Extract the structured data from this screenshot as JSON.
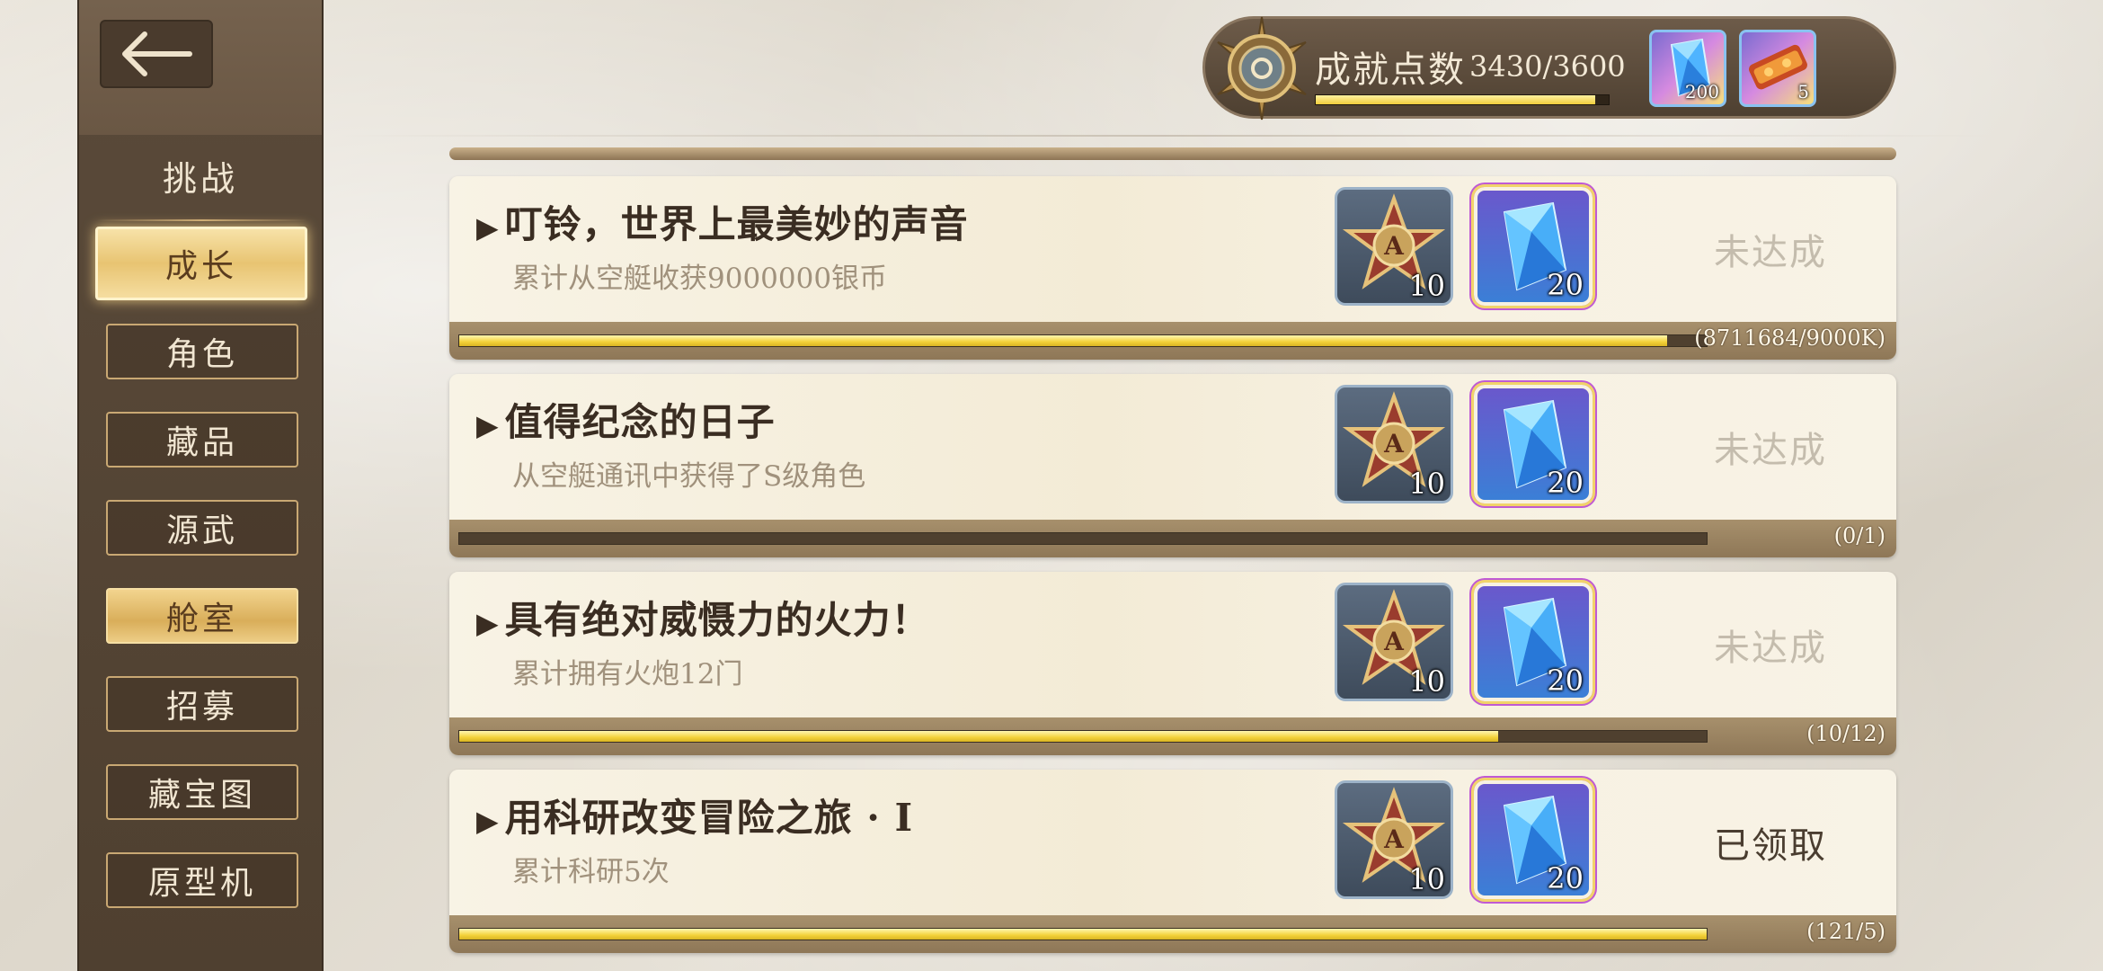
{
  "sidebar": {
    "back_icon": "back-arrow-icon",
    "section_label": "挑战",
    "items": [
      {
        "label": "成长",
        "state": "active"
      },
      {
        "label": "角色",
        "state": "normal"
      },
      {
        "label": "藏品",
        "state": "normal"
      },
      {
        "label": "源武",
        "state": "normal"
      },
      {
        "label": "舱室",
        "state": "highlight"
      },
      {
        "label": "招募",
        "state": "normal"
      },
      {
        "label": "藏宝图",
        "state": "normal"
      },
      {
        "label": "原型机",
        "state": "normal"
      }
    ]
  },
  "header": {
    "points_label": "成就点数",
    "points_value": "3430/3600",
    "points_progress": 0.953,
    "rewards": [
      {
        "icon": "blue-crystal-icon",
        "count": "200"
      },
      {
        "icon": "red-scroll-icon",
        "count": "5"
      }
    ]
  },
  "achievements": [
    {
      "title": "叮铃，世界上最美妙的声音",
      "desc": "累计从空艇收获9000000银币",
      "reward_star_count": "10",
      "reward_crystal_count": "20",
      "status": "未达成",
      "progress_text": "(8711684/9000K)",
      "progress": 0.968
    },
    {
      "title": "值得纪念的日子",
      "desc": "从空艇通讯中获得了S级角色",
      "reward_star_count": "10",
      "reward_crystal_count": "20",
      "status": "未达成",
      "progress_text": "(0/1)",
      "progress": 0
    },
    {
      "title": "具有绝对威慑力的火力！",
      "desc": "累计拥有火炮12门",
      "reward_star_count": "10",
      "reward_crystal_count": "20",
      "status": "未达成",
      "progress_text": "(10/12)",
      "progress": 0.833
    },
    {
      "title": "用科研改变冒险之旅 · Ⅰ",
      "desc": "累计科研5次",
      "reward_star_count": "10",
      "reward_crystal_count": "20",
      "status": "已领取",
      "progress_text": "(121/5)",
      "progress": 1
    }
  ]
}
